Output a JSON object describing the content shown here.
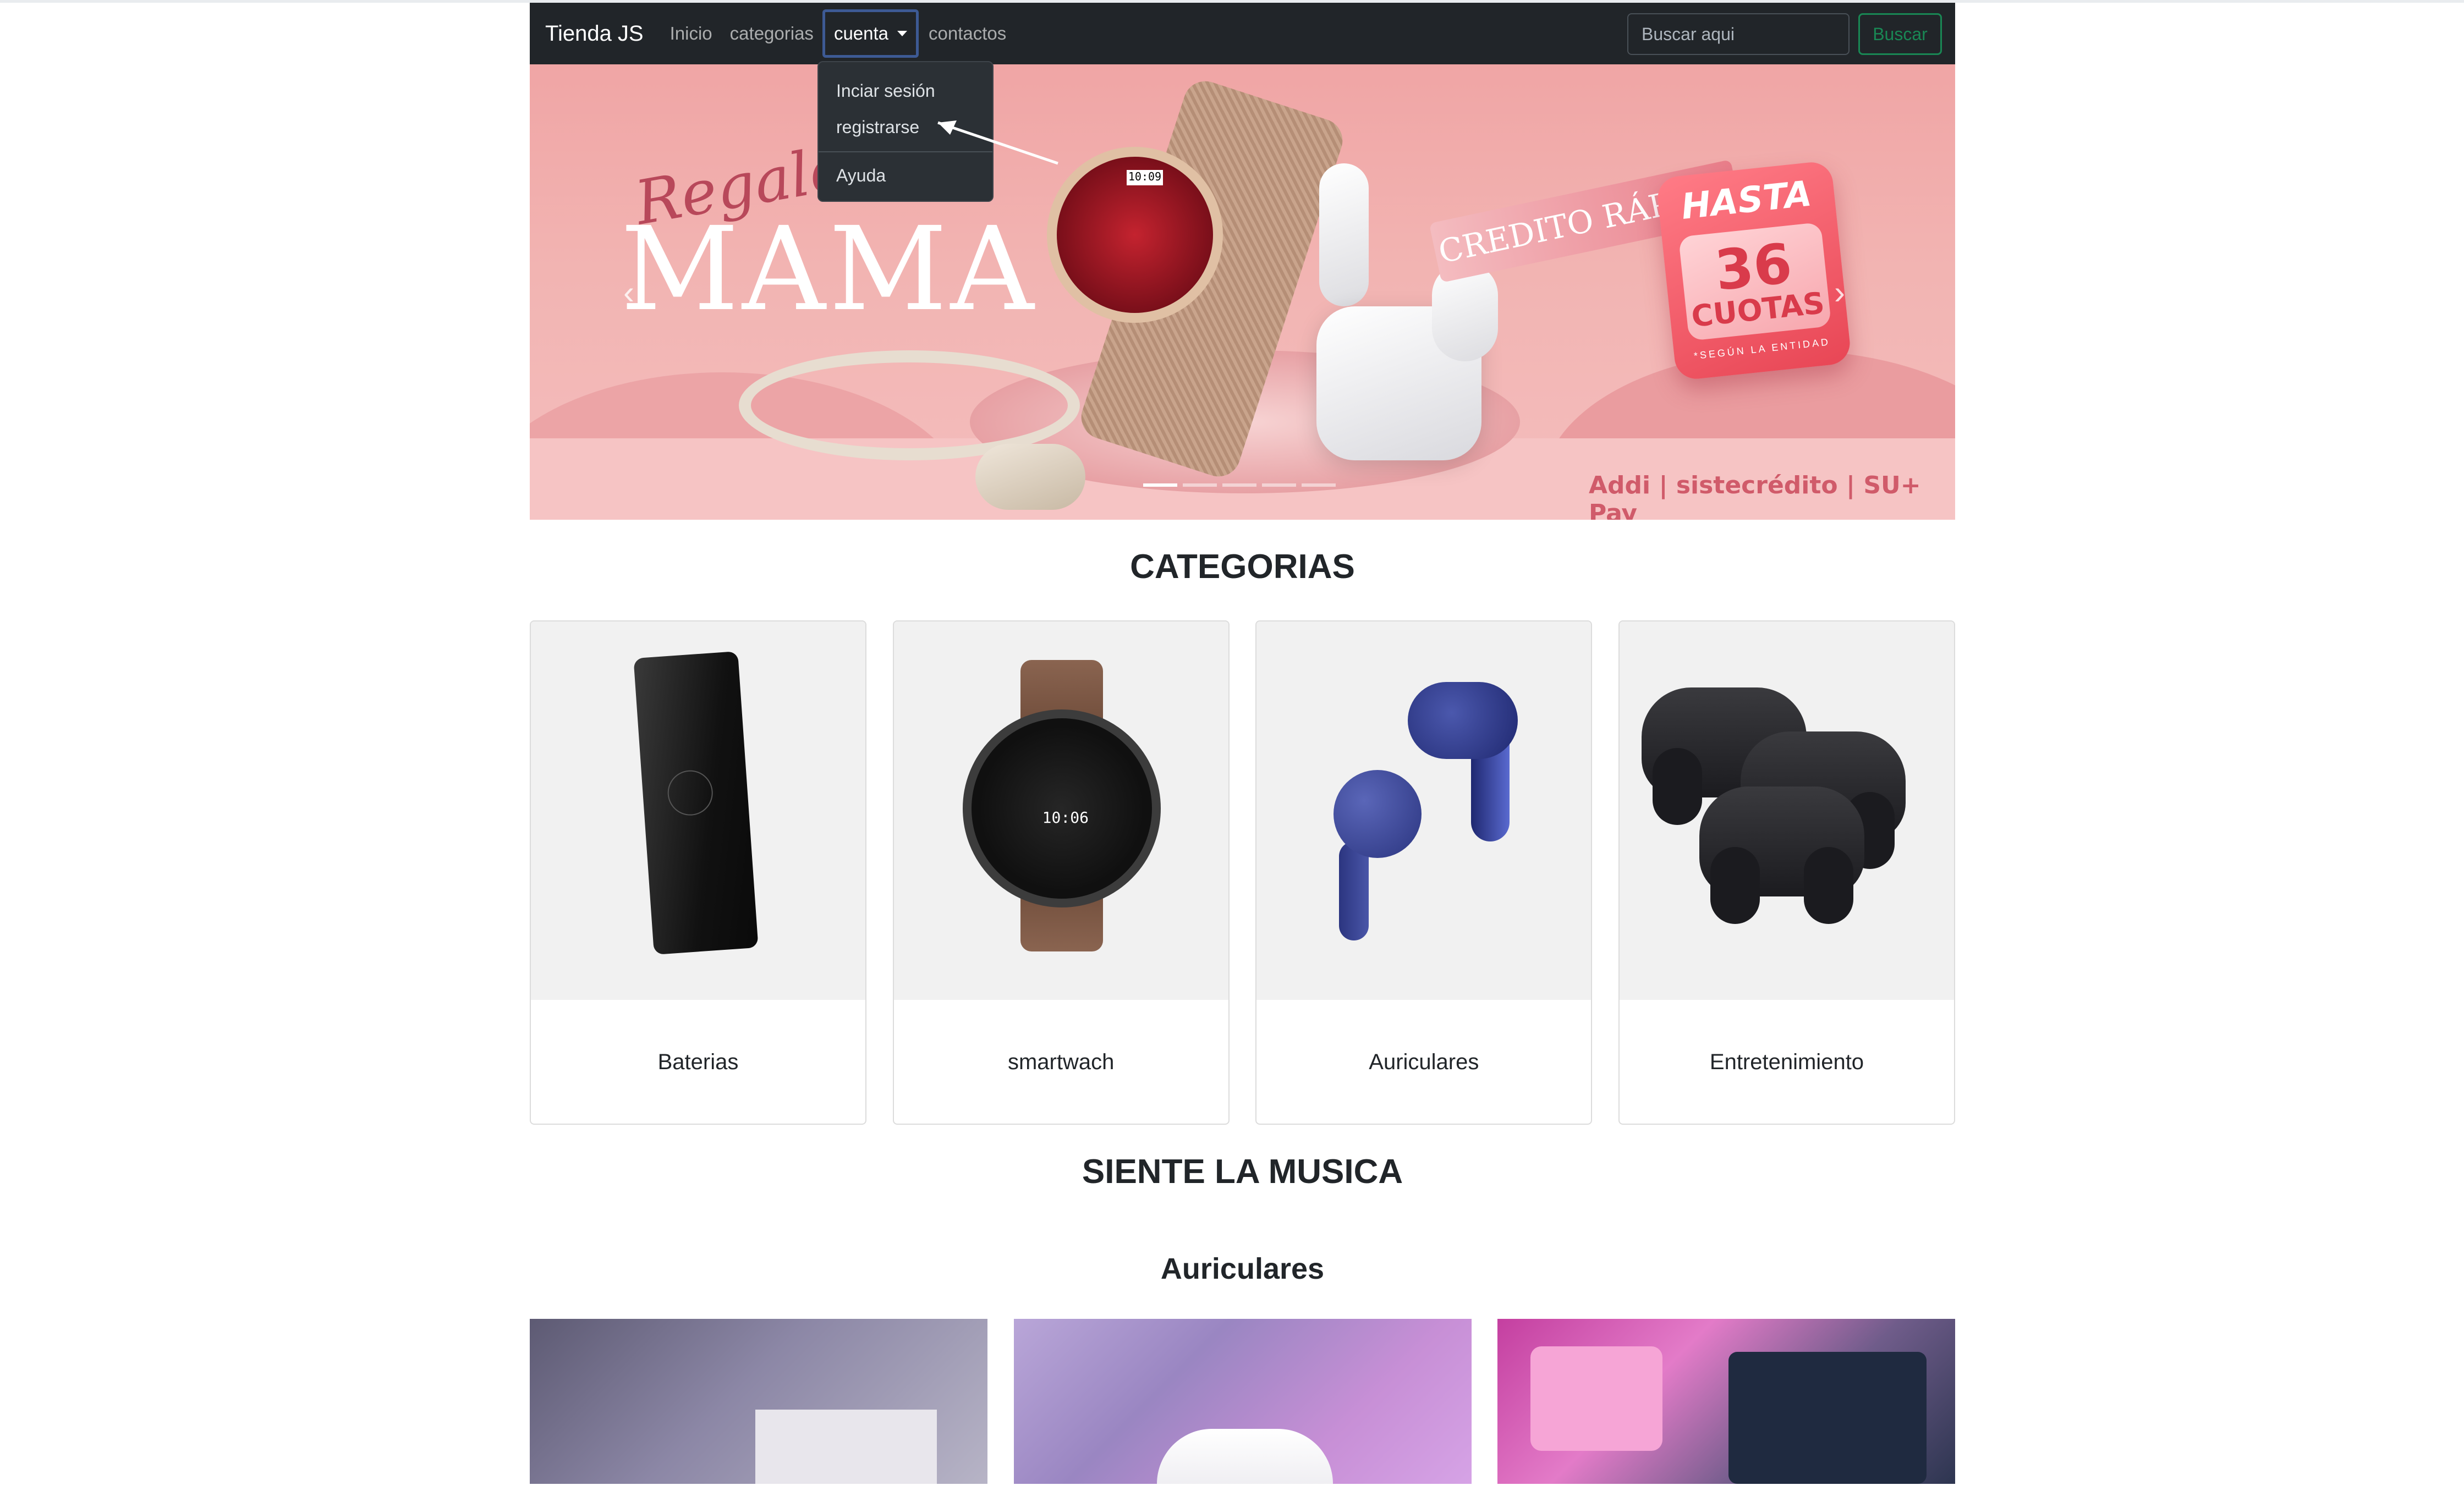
{
  "navbar": {
    "brand": "Tienda JS",
    "links": {
      "inicio": "Inicio",
      "categorias": "categorias",
      "cuenta": "cuenta",
      "contactos": "contactos"
    },
    "search_placeholder": "Buscar aqui",
    "search_button": "Buscar"
  },
  "dropdown": {
    "items": {
      "login": "Inciar sesión",
      "register": "registrarse",
      "help": "Ayuda"
    }
  },
  "hero": {
    "script": "Regalo i",
    "headline": "MAMA",
    "watch_time": "10:09",
    "ribbon": "CREDITO RÁPIDO",
    "badge_top": "HASTA",
    "badge_number": "36",
    "badge_bottom": "CUOTAS",
    "badge_note": "*SEGÚN LA ENTIDAD",
    "partners": "Addi | sistecrédito | SU+ Pay",
    "prev": "‹",
    "next": "›",
    "active_slide": 1,
    "slide_count": 5
  },
  "categories": {
    "title": "CATEGORIAS",
    "items": [
      {
        "label": "Baterias",
        "icon": "power-bank"
      },
      {
        "label": "smartwach",
        "icon": "smartwatch"
      },
      {
        "label": "Auriculares",
        "icon": "earbuds"
      },
      {
        "label": "Entretenimiento",
        "icon": "gamepads"
      }
    ],
    "watch_time": "10:06"
  },
  "music": {
    "title": "SIENTE LA MUSICA",
    "subtitle": "Auriculares"
  },
  "colors": {
    "navbar_bg": "#212529",
    "search_btn": "#198754",
    "card_border": "#dcdcdc",
    "hero_pink": "#f0a5a5"
  }
}
